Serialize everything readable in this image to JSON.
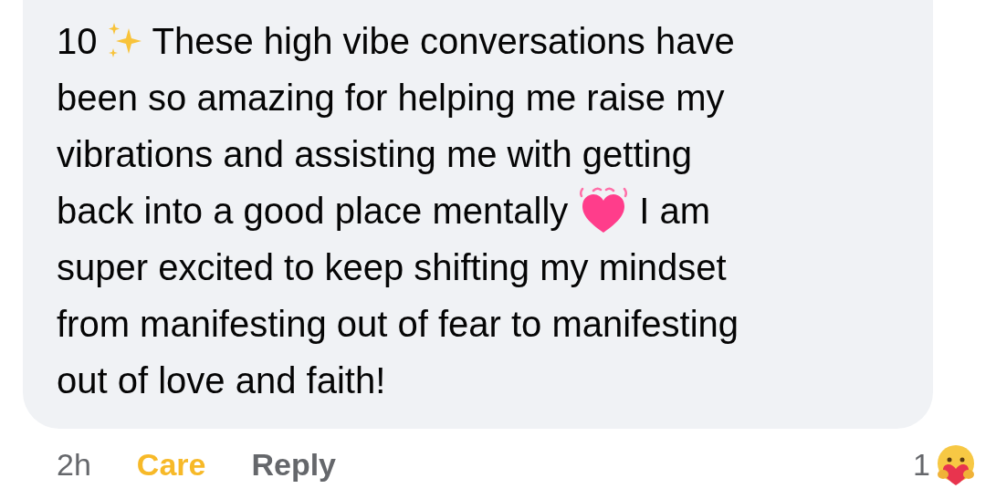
{
  "comment": {
    "lines": [
      [
        {
          "kind": "text",
          "text": "10"
        },
        {
          "kind": "sparkles"
        },
        {
          "kind": "text",
          "text": "These high vibe conversations have"
        }
      ],
      [
        {
          "kind": "text",
          "text": "been so amazing for helping me raise my"
        }
      ],
      [
        {
          "kind": "text",
          "text": "vibrations and assisting me with getting"
        }
      ],
      [
        {
          "kind": "text",
          "text": "back into a good place mentally"
        },
        {
          "kind": "heart"
        },
        {
          "kind": "text",
          "text": "I am"
        }
      ],
      [
        {
          "kind": "text",
          "text": "super excited to keep shifting my mindset"
        }
      ],
      [
        {
          "kind": "text",
          "text": "from manifesting out of fear to manifesting"
        }
      ],
      [
        {
          "kind": "text",
          "text": "out of love and faith!"
        }
      ]
    ]
  },
  "footer": {
    "time": "2h",
    "reaction": {
      "label": "Care",
      "selected": true
    },
    "reply": "Reply",
    "reaction_count": "1"
  }
}
